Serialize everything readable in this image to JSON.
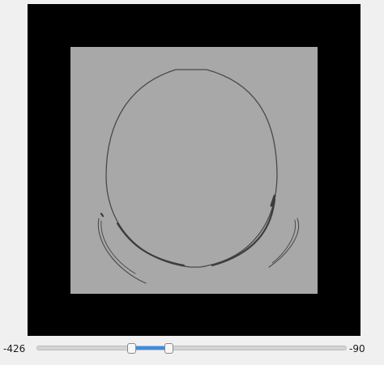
{
  "slider": {
    "min_label": "-426",
    "max_label": "-90",
    "range_fill_color": "#3a8ee6",
    "low_fraction": 0.306,
    "high_fraction": 0.426
  },
  "viewer": {
    "background_color": "#000000",
    "image_gray": "#a8a8a8"
  }
}
